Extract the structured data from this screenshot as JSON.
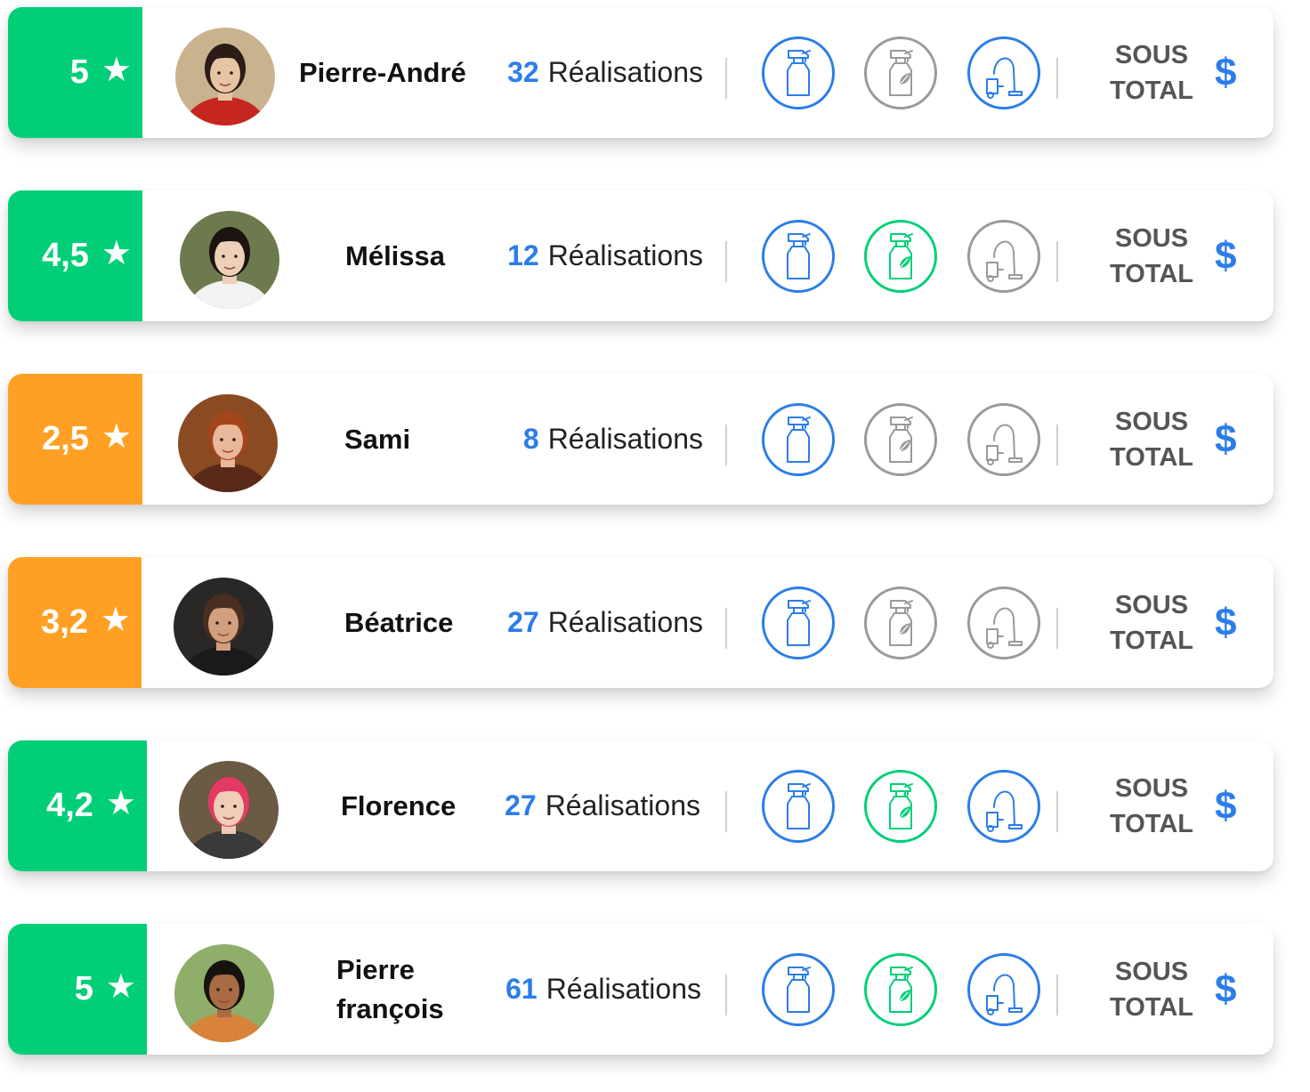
{
  "colors": {
    "green": "#00cf78",
    "orange": "#ffa024",
    "blue": "#2b7de9",
    "gray": "#9a9a9a"
  },
  "subtotal": {
    "line1": "SOUS",
    "line2": "TOTAL",
    "currency": "$"
  },
  "star_glyph": "★",
  "realisations_label": "Réalisations",
  "providers": [
    {
      "rating": "5",
      "rating_color": "green",
      "name_line1": "Pierre-André",
      "name_line2": "",
      "count": "32",
      "services": {
        "spray": "active",
        "eco_spray": "inactive",
        "vacuum": "active"
      },
      "avatar": {
        "bg": "#c9b38f",
        "skin": "#e7c4a3",
        "hair": "#2b1d16",
        "top": "#c62620"
      }
    },
    {
      "rating": "4,5",
      "rating_color": "green",
      "name_line1": "Mélissa",
      "name_line2": "",
      "count": "12",
      "services": {
        "spray": "active",
        "eco_spray": "active",
        "vacuum": "inactive"
      },
      "avatar": {
        "bg": "#6d7a4e",
        "skin": "#edd0b8",
        "hair": "#1b1411",
        "top": "#f2f2f2"
      }
    },
    {
      "rating": "2,5",
      "rating_color": "orange",
      "name_line1": "Sami",
      "name_line2": "",
      "count": "8",
      "services": {
        "spray": "active",
        "eco_spray": "inactive",
        "vacuum": "inactive"
      },
      "avatar": {
        "bg": "#8a4a22",
        "skin": "#e9b79a",
        "hair": "#a2461c",
        "top": "#5a2a18"
      }
    },
    {
      "rating": "3,2",
      "rating_color": "orange",
      "name_line1": "Béatrice",
      "name_line2": "",
      "count": "27",
      "services": {
        "spray": "active",
        "eco_spray": "inactive",
        "vacuum": "inactive"
      },
      "avatar": {
        "bg": "#2a2727",
        "skin": "#d2a07e",
        "hair": "#4a2f20",
        "top": "#1a1a1a"
      }
    },
    {
      "rating": "4,2",
      "rating_color": "green",
      "name_line1": "Florence",
      "name_line2": "",
      "count": "27",
      "services": {
        "spray": "active",
        "eco_spray": "active",
        "vacuum": "active"
      },
      "avatar": {
        "bg": "#6b5a44",
        "skin": "#f0cdb8",
        "hair": "#e23a64",
        "top": "#3a3a3a"
      }
    },
    {
      "rating": "5",
      "rating_color": "green",
      "name_line1": "Pierre",
      "name_line2": "françois",
      "count": "61",
      "services": {
        "spray": "active",
        "eco_spray": "active",
        "vacuum": "active"
      },
      "avatar": {
        "bg": "#8fae6a",
        "skin": "#a86b45",
        "hair": "#161210",
        "top": "#d9823b"
      }
    }
  ]
}
